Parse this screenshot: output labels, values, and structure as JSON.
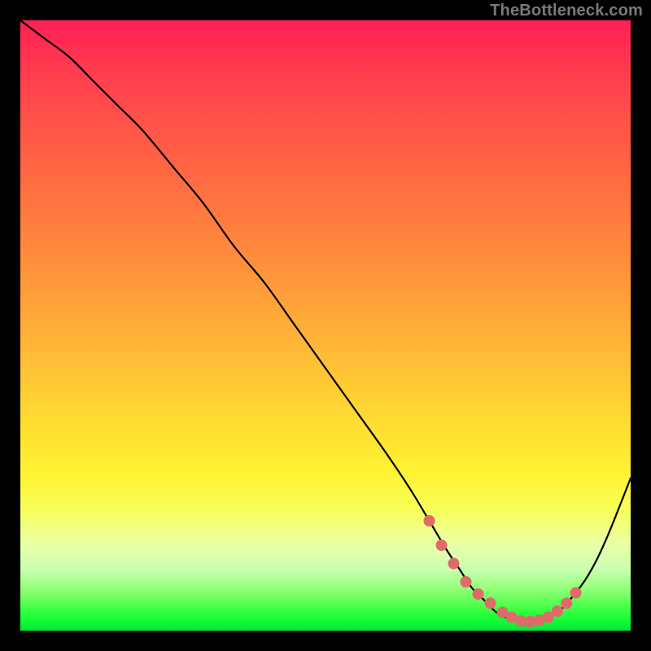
{
  "watermark": "TheBottleneck.com",
  "chart_data": {
    "type": "line",
    "title": "",
    "xlabel": "",
    "ylabel": "",
    "xlim": [
      0,
      100
    ],
    "ylim": [
      0,
      100
    ],
    "grid": false,
    "legend": false,
    "series": [
      {
        "name": "curve",
        "x": [
          0,
          4,
          8,
          12,
          16,
          20,
          25,
          30,
          35,
          40,
          45,
          50,
          55,
          60,
          64,
          67,
          70,
          72,
          74,
          76,
          78,
          80,
          82,
          84,
          86,
          88,
          90,
          93,
          96,
          100
        ],
        "y": [
          100,
          97,
          94,
          90,
          86,
          82,
          76,
          70,
          63,
          57,
          50,
          43,
          36,
          29,
          23,
          18,
          13,
          10,
          7,
          5,
          3,
          2,
          1.5,
          1.5,
          2,
          3,
          5,
          9,
          15,
          25
        ]
      }
    ],
    "highlight_points": {
      "name": "optimal-range",
      "x": [
        67,
        69,
        71,
        73,
        75,
        77,
        79,
        80.5,
        82,
        83.5,
        85,
        86.5,
        88,
        89.5,
        91
      ],
      "y": [
        18,
        14,
        11,
        8,
        6,
        4.5,
        3,
        2.2,
        1.6,
        1.5,
        1.7,
        2.2,
        3.2,
        4.5,
        6.2
      ]
    },
    "gradient_colors": {
      "top": "#ff1f55",
      "mid": "#ffd733",
      "bottom": "#00e63a"
    }
  }
}
